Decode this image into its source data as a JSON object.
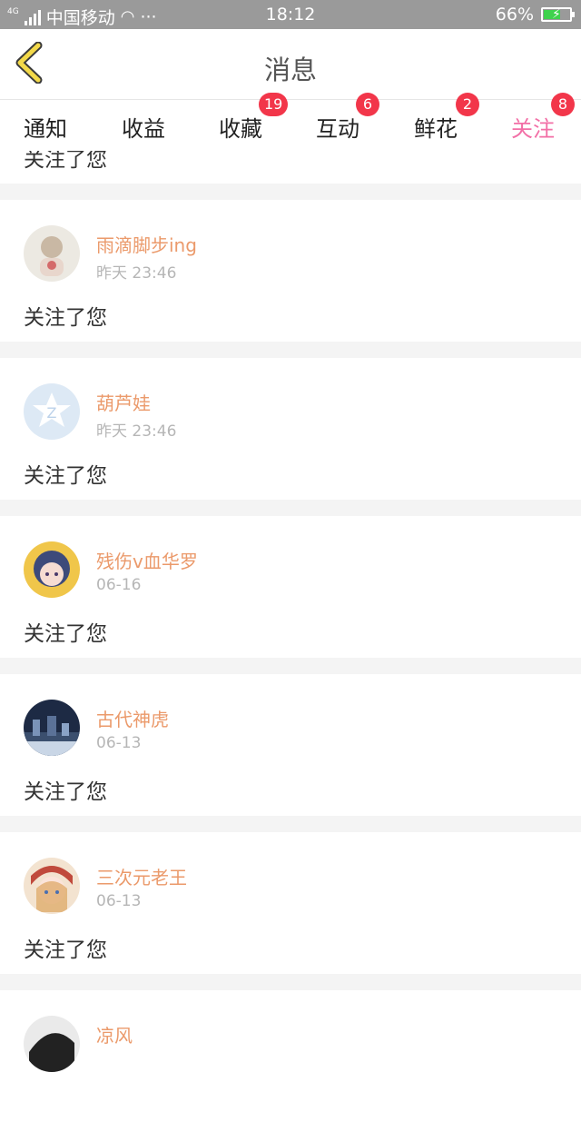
{
  "status_bar": {
    "network": "4G",
    "carrier": "中国移动",
    "time": "18:12",
    "battery": "66%",
    "battery_level": 0.66
  },
  "header": {
    "title": "消息"
  },
  "tabs": [
    {
      "label": "通知",
      "badge": ""
    },
    {
      "label": "收益",
      "badge": ""
    },
    {
      "label": "收藏",
      "badge": "19"
    },
    {
      "label": "互动",
      "badge": "6"
    },
    {
      "label": "鲜花",
      "badge": "2"
    },
    {
      "label": "关注",
      "badge": "8",
      "active": true
    }
  ],
  "partial_item": {
    "message": "关注了您"
  },
  "follows": [
    {
      "name": "雨滴脚步ing",
      "time": "昨天 23:46",
      "message": "关注了您"
    },
    {
      "name": "葫芦娃",
      "time": "昨天 23:46",
      "message": "关注了您"
    },
    {
      "name": "残伤v血华罗",
      "time": "06-16",
      "message": "关注了您"
    },
    {
      "name": "古代神虎",
      "time": "06-13",
      "message": "关注了您"
    },
    {
      "name": "三次元老王",
      "time": "06-13",
      "message": "关注了您"
    },
    {
      "name": "凉风",
      "time": "",
      "message": ""
    }
  ],
  "colors": {
    "accent": "#f26fa6",
    "badge": "#f2364a",
    "username": "#eb9a6b"
  }
}
